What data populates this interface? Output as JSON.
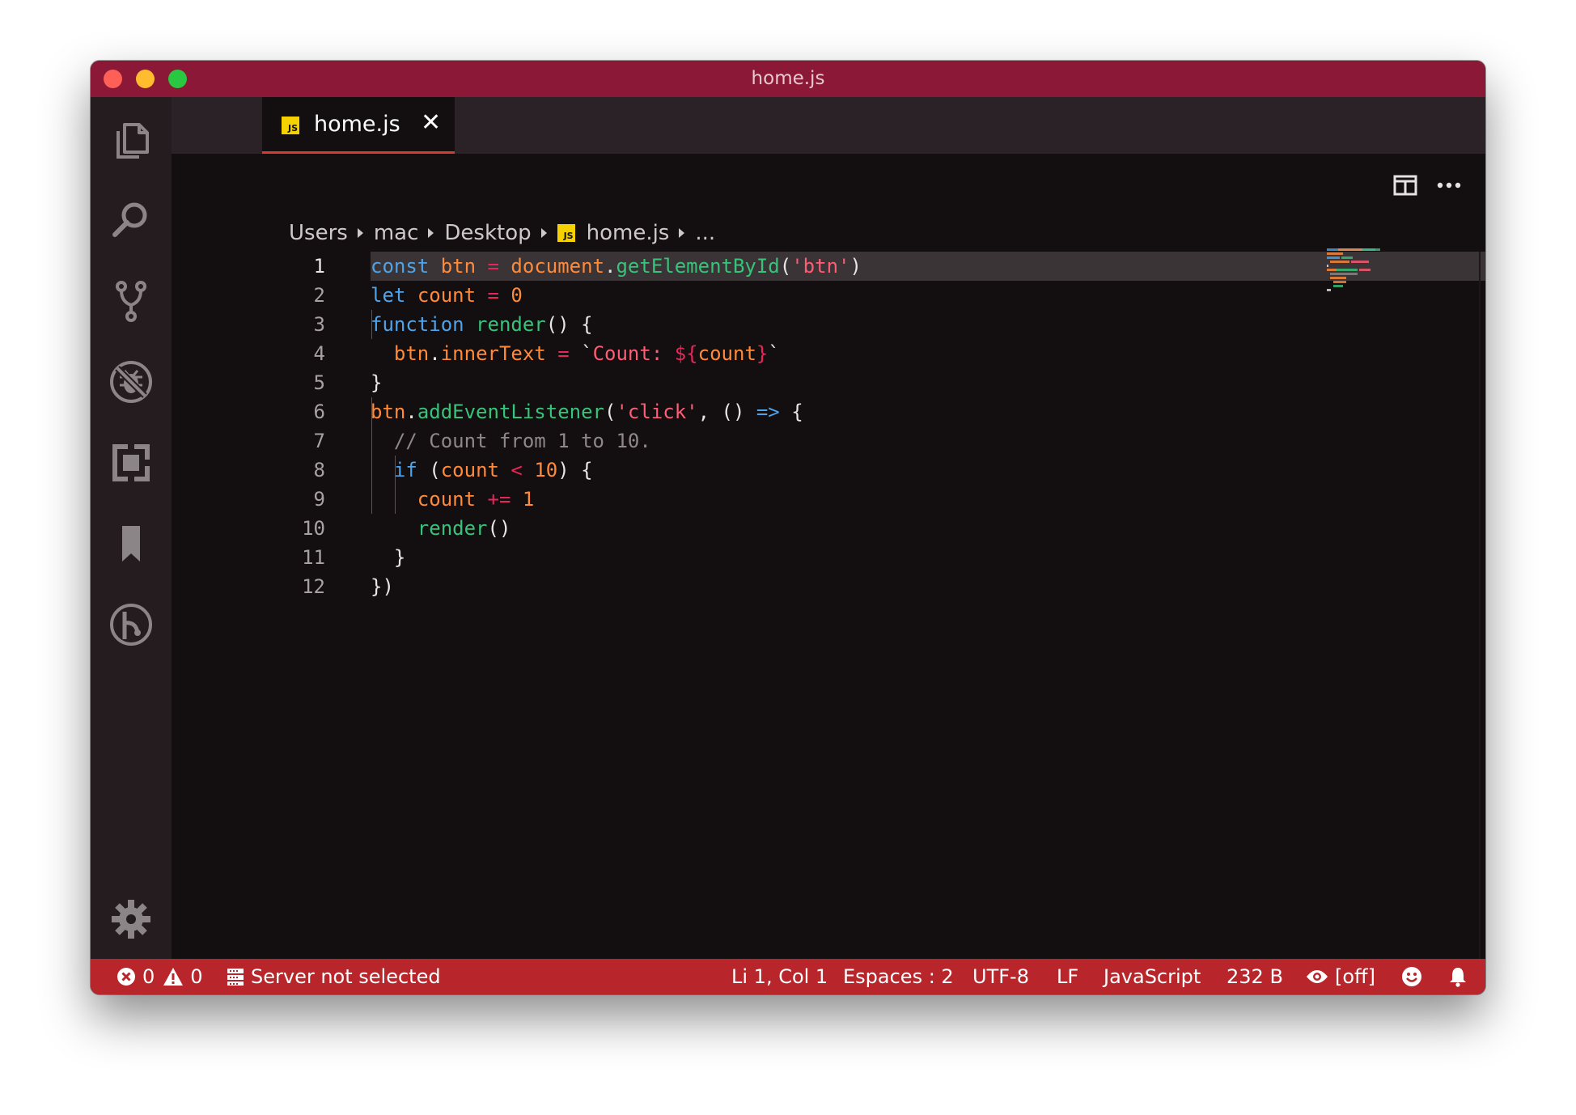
{
  "window": {
    "title": "home.js"
  },
  "activity_bar": {
    "items": [
      {
        "name": "explorer-icon"
      },
      {
        "name": "search-icon"
      },
      {
        "name": "source-control-icon"
      },
      {
        "name": "debug-icon"
      },
      {
        "name": "extensions-icon"
      },
      {
        "name": "bookmarks-icon"
      },
      {
        "name": "gitlens-icon"
      },
      {
        "name": "settings-gear-icon"
      }
    ]
  },
  "tabs": [
    {
      "label": "home.js",
      "badge": "JS",
      "active": true,
      "close": "✕"
    }
  ],
  "breadcrumb": {
    "items": [
      "Users",
      "mac",
      "Desktop",
      "home.js",
      "..."
    ],
    "file_badge": "JS"
  },
  "editor": {
    "cursor_line": 1,
    "lines": [
      {
        "num": "1",
        "tokens": [
          [
            "kw",
            "const"
          ],
          [
            "pun",
            " "
          ],
          [
            "var",
            "btn"
          ],
          [
            "pun",
            " "
          ],
          [
            "op",
            "="
          ],
          [
            "pun",
            " "
          ],
          [
            "var",
            "document"
          ],
          [
            "pun",
            "."
          ],
          [
            "fn",
            "getElementById"
          ],
          [
            "pun",
            "("
          ],
          [
            "str",
            "'btn'"
          ],
          [
            "pun",
            ")"
          ]
        ]
      },
      {
        "num": "2",
        "tokens": [
          [
            "kw",
            "let"
          ],
          [
            "pun",
            " "
          ],
          [
            "var",
            "count"
          ],
          [
            "pun",
            " "
          ],
          [
            "op",
            "="
          ],
          [
            "pun",
            " "
          ],
          [
            "num",
            "0"
          ]
        ]
      },
      {
        "num": "3",
        "tokens": [
          [
            "kw",
            "function"
          ],
          [
            "pun",
            " "
          ],
          [
            "fn",
            "render"
          ],
          [
            "pun",
            "() {"
          ]
        ]
      },
      {
        "num": "4",
        "tokens": [
          [
            "pun",
            "  "
          ],
          [
            "var",
            "btn"
          ],
          [
            "pun",
            "."
          ],
          [
            "var",
            "innerText"
          ],
          [
            "pun",
            " "
          ],
          [
            "op",
            "="
          ],
          [
            "pun",
            " `"
          ],
          [
            "str",
            "Count: "
          ],
          [
            "op",
            "${"
          ],
          [
            "var",
            "count"
          ],
          [
            "op",
            "}"
          ],
          [
            "pun",
            "`"
          ]
        ]
      },
      {
        "num": "5",
        "tokens": [
          [
            "pun",
            "}"
          ]
        ]
      },
      {
        "num": "6",
        "tokens": [
          [
            "var",
            "btn"
          ],
          [
            "pun",
            "."
          ],
          [
            "fn",
            "addEventListener"
          ],
          [
            "pun",
            "("
          ],
          [
            "str",
            "'click'"
          ],
          [
            "pun",
            ", () "
          ],
          [
            "kw",
            "=>"
          ],
          [
            "pun",
            " {"
          ]
        ]
      },
      {
        "num": "7",
        "tokens": [
          [
            "pun",
            "  "
          ],
          [
            "com",
            "// Count from 1 to 10."
          ]
        ]
      },
      {
        "num": "8",
        "tokens": [
          [
            "pun",
            "  "
          ],
          [
            "kw",
            "if"
          ],
          [
            "pun",
            " ("
          ],
          [
            "var",
            "count"
          ],
          [
            "pun",
            " "
          ],
          [
            "op",
            "<"
          ],
          [
            "pun",
            " "
          ],
          [
            "num",
            "10"
          ],
          [
            "pun",
            ") {"
          ]
        ]
      },
      {
        "num": "9",
        "tokens": [
          [
            "pun",
            "    "
          ],
          [
            "var",
            "count"
          ],
          [
            "pun",
            " "
          ],
          [
            "op",
            "+="
          ],
          [
            "pun",
            " "
          ],
          [
            "num",
            "1"
          ]
        ]
      },
      {
        "num": "10",
        "tokens": [
          [
            "pun",
            "    "
          ],
          [
            "fn",
            "render"
          ],
          [
            "pun",
            "()"
          ]
        ]
      },
      {
        "num": "11",
        "tokens": [
          [
            "pun",
            "  }"
          ]
        ]
      },
      {
        "num": "12",
        "tokens": [
          [
            "pun",
            "})"
          ]
        ]
      }
    ]
  },
  "status_bar": {
    "errors": "0",
    "warnings": "0",
    "server": "Server not selected",
    "position": "Li 1, Col 1",
    "indent": "Espaces : 2",
    "encoding": "UTF-8",
    "eol": "LF",
    "language": "JavaScript",
    "size": "232 B",
    "live_preview": "[off]"
  },
  "colors": {
    "titlebar": "#8c1838",
    "statusbar": "#b8262b",
    "editor_bg": "#130e10",
    "tab_underline": "#d93a32"
  }
}
